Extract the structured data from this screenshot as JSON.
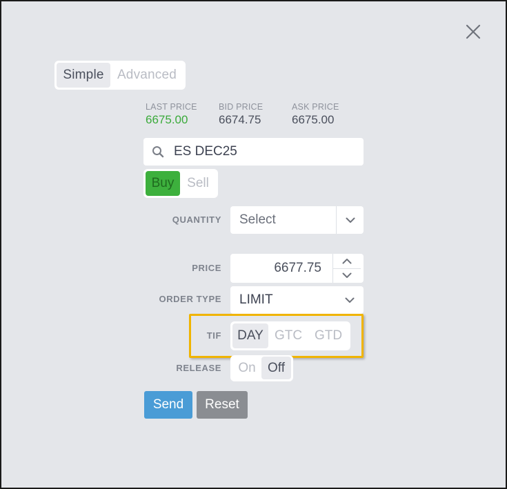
{
  "mode_tabs": [
    {
      "label": "Simple",
      "active": true
    },
    {
      "label": "Advanced",
      "active": false
    }
  ],
  "quotes": {
    "last": {
      "label": "LAST PRICE",
      "value": "6675.00",
      "color": "#3aaa3a"
    },
    "bid": {
      "label": "BID PRICE",
      "value": "6674.75"
    },
    "ask": {
      "label": "ASK PRICE",
      "value": "6675.00"
    }
  },
  "symbol": {
    "value": "ES DEC25",
    "icon": "search-icon"
  },
  "side": {
    "buy_label": "Buy",
    "sell_label": "Sell",
    "selected": "Buy",
    "buy_color": "#3db03d"
  },
  "quantity": {
    "label": "QUANTITY",
    "value": "Select"
  },
  "price": {
    "label": "PRICE",
    "value": "6677.75"
  },
  "order_type": {
    "label": "ORDER TYPE",
    "value": "LIMIT"
  },
  "tif": {
    "label": "TIF",
    "options": [
      "DAY",
      "GTC",
      "GTD"
    ],
    "selected": "DAY",
    "highlight_color": "#f0b400"
  },
  "release": {
    "label": "RELEASE",
    "options": [
      "On",
      "Off"
    ],
    "selected": "Off"
  },
  "actions": {
    "send_label": "Send",
    "reset_label": "Reset",
    "send_color": "#4a9cd6",
    "reset_color": "#8a8d92"
  }
}
